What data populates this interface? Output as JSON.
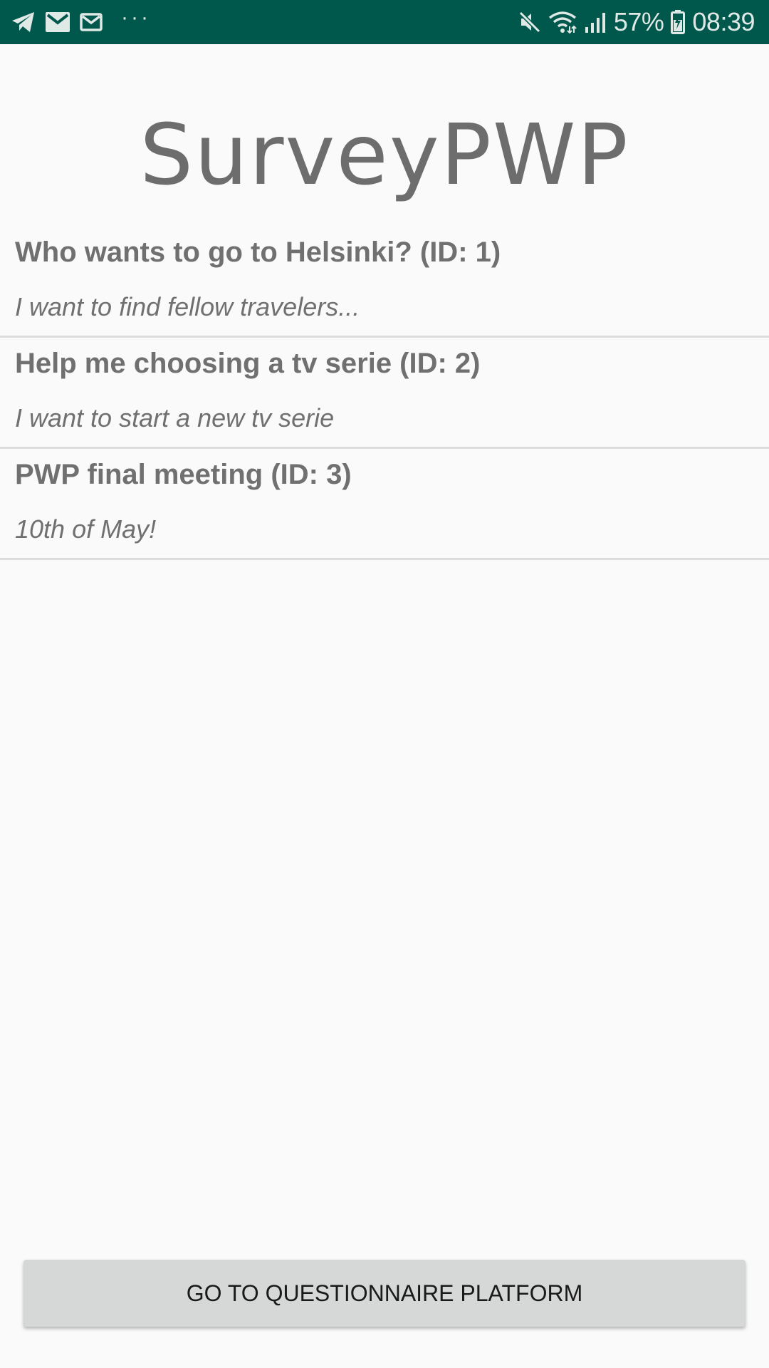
{
  "status_bar": {
    "left_icons": [
      "telegram-icon",
      "gmail-icon",
      "gmail-outline-icon"
    ],
    "more_notifications": "···",
    "right_icons": [
      "mute-icon",
      "wifi-icon",
      "signal-icon",
      "battery-icon"
    ],
    "battery_percent": "57%",
    "time": "08:39",
    "background_color": "#00574b"
  },
  "app": {
    "title": "SurveyPWP"
  },
  "surveys": [
    {
      "title": "Who wants to go to Helsinki? (ID: 1)",
      "description": "I want to find fellow travelers..."
    },
    {
      "title": "Help me choosing a tv serie (ID: 2)",
      "description": "I want to start a new tv serie"
    },
    {
      "title": "PWP final meeting (ID: 3)",
      "description": "10th of May!"
    }
  ],
  "footer": {
    "button_label": "GO TO QUESTIONNAIRE PLATFORM"
  }
}
